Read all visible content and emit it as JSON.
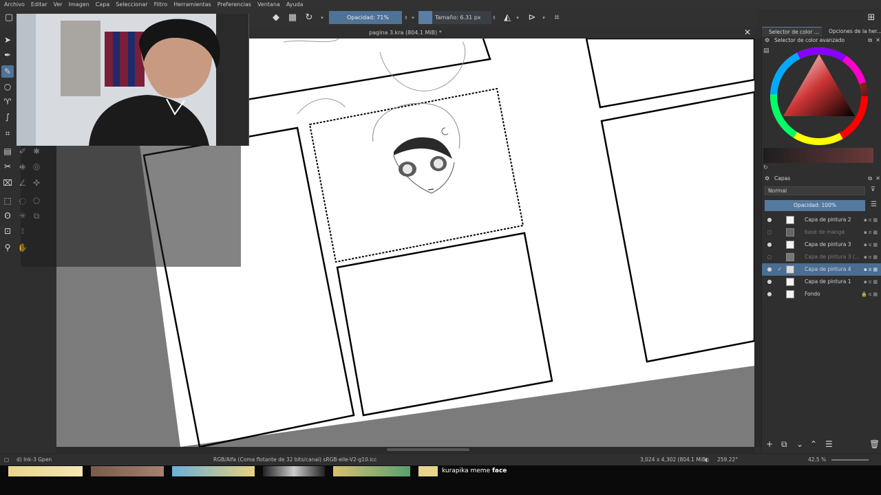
{
  "menu": [
    "Archivo",
    "Editar",
    "Ver",
    "Imagen",
    "Capa",
    "Seleccionar",
    "Filtro",
    "Herramientas",
    "Preferencias",
    "Ventana",
    "Ayuda"
  ],
  "toolbar": {
    "opacity_label": "Opacidad: 71%",
    "opacity_value": 0.71,
    "size_label": "Tamaño: 6.31 px"
  },
  "document": {
    "title": "pagina 3.kra (804.1 MiB) *"
  },
  "color_panel": {
    "tab_active": "Selector de color ...",
    "tab_other": "Opciones de la her...",
    "title": "Selector de color avanzado"
  },
  "layers_panel": {
    "title": "Capas",
    "blend_mode": "Normal",
    "opacity_label": "Opacidad:  100%",
    "layers": [
      {
        "name": "Capa de pintura 2",
        "visible": true,
        "selected": false,
        "dim": false
      },
      {
        "name": "base de manga",
        "visible": false,
        "selected": false,
        "dim": true
      },
      {
        "name": "Capa de pintura 3",
        "visible": true,
        "selected": false,
        "dim": false
      },
      {
        "name": "Capa de pintura 3 (...",
        "visible": false,
        "selected": false,
        "dim": true
      },
      {
        "name": "Capa de pintura 4",
        "visible": true,
        "selected": true,
        "dim": false
      },
      {
        "name": "Capa de pintura 1",
        "visible": true,
        "selected": false,
        "dim": false
      },
      {
        "name": "Fondo",
        "visible": true,
        "selected": false,
        "dim": false
      }
    ]
  },
  "status": {
    "brush": "d) Ink-3 Gpen",
    "color_space": "RGB/Alfa (Coma flotante de 32 bits/canal)  sRGB-elle-V2-g10.icc",
    "dimensions": "3,024 x 4,302 (804.1 MiB)",
    "rotation": "259.22°",
    "zoom": "42.5 %"
  },
  "taskbar": {
    "label_prefix": "kurapika meme",
    "label_bold": "face"
  }
}
